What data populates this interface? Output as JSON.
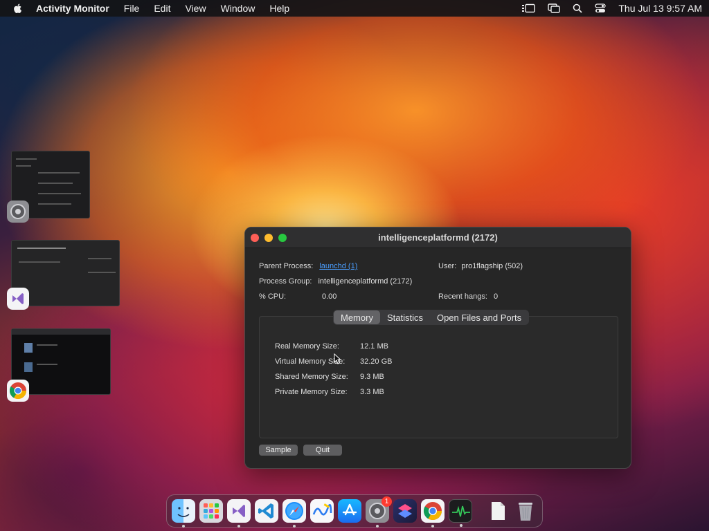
{
  "menubar": {
    "app_name": "Activity Monitor",
    "items": [
      "File",
      "Edit",
      "View",
      "Window",
      "Help"
    ],
    "clock": "Thu Jul 13  9:57 AM"
  },
  "window": {
    "title": "intelligenceplatformd (2172)",
    "parent_process_label": "Parent Process:",
    "parent_process_value": "launchd (1)",
    "user_label": "User:",
    "user_value": "pro1flagship (502)",
    "process_group_label": "Process Group:",
    "process_group_value": "intelligenceplatformd (2172)",
    "cpu_label": "% CPU:",
    "cpu_value": "0.00",
    "hangs_label": "Recent hangs:",
    "hangs_value": "0",
    "tabs": [
      "Memory",
      "Statistics",
      "Open Files and Ports"
    ],
    "active_tab": "Memory",
    "memory": [
      {
        "label": "Real Memory Size:",
        "value": "12.1 MB"
      },
      {
        "label": "Virtual Memory Size:",
        "value": "32.20 GB"
      },
      {
        "label": "Shared Memory Size:",
        "value": "9.3 MB"
      },
      {
        "label": "Private Memory Size:",
        "value": "3.3 MB"
      }
    ],
    "sample_button": "Sample",
    "quit_button": "Quit"
  },
  "dock": {
    "apps": [
      {
        "name": "finder-icon",
        "running": true
      },
      {
        "name": "launchpad-icon",
        "running": false
      },
      {
        "name": "visual-studio-icon",
        "running": true
      },
      {
        "name": "vscode-icon",
        "running": false
      },
      {
        "name": "safari-icon",
        "running": true
      },
      {
        "name": "freeform-icon",
        "running": false
      },
      {
        "name": "app-store-icon",
        "running": false
      },
      {
        "name": "system-settings-icon",
        "running": true,
        "badge": "1"
      },
      {
        "name": "shortcuts-icon",
        "running": false
      },
      {
        "name": "chrome-icon",
        "running": true
      },
      {
        "name": "activity-monitor-icon",
        "running": true
      }
    ]
  },
  "colors": {
    "accent_link": "#4a9eff",
    "close": "#fe5f57",
    "minimize": "#febc2e",
    "maximize": "#28c840"
  }
}
